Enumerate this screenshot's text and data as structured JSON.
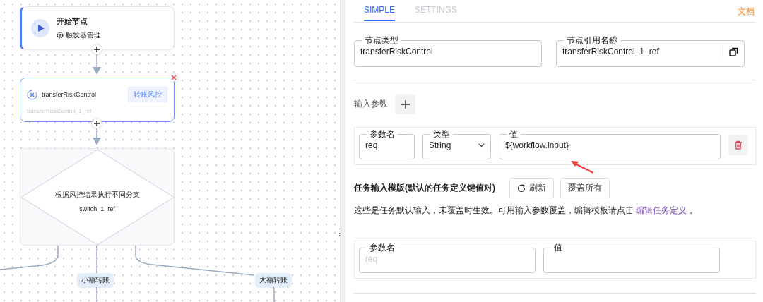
{
  "canvas": {
    "start_node": {
      "title": "开始节点",
      "subtitle": "触发器管理"
    },
    "task_node": {
      "name": "transferRiskControl",
      "tag": "转账风控",
      "ref": "transferRiskControl_1_ref",
      "selected": true
    },
    "switch_node": {
      "description": "根据风控结果执行不同分支",
      "ref": "switch_1_ref"
    },
    "branches": [
      "小额转账",
      "大额转账"
    ]
  },
  "panel": {
    "tabs": [
      {
        "label": "SIMPLE",
        "selected": true
      },
      {
        "label": "SETTINGS",
        "selected": false
      }
    ],
    "docs_link": "文档",
    "node_type": {
      "label": "节点类型",
      "value": "transferRiskControl"
    },
    "node_ref": {
      "label": "节点引用名称",
      "value": "transferRiskControl_1_ref"
    },
    "input_params": {
      "title": "输入参数",
      "rows": [
        {
          "name_label": "参数名",
          "name": "req",
          "type_label": "类型",
          "type": "String",
          "value_label": "值",
          "value": "${workflow.input}"
        }
      ]
    },
    "template": {
      "title": "任务输入模版(默认的任务定义键值对)",
      "buttons": [
        "刷新",
        "覆盖所有"
      ],
      "note": "这些是任务默认输入，未覆盖时生效。可用输入参数覆盖，编辑模板请点击",
      "note_link": "编辑任务定义",
      "note_end": "。",
      "rows": [
        {
          "name_label": "参数名",
          "name_placeholder": "req",
          "value_label": "值"
        }
      ]
    }
  }
}
